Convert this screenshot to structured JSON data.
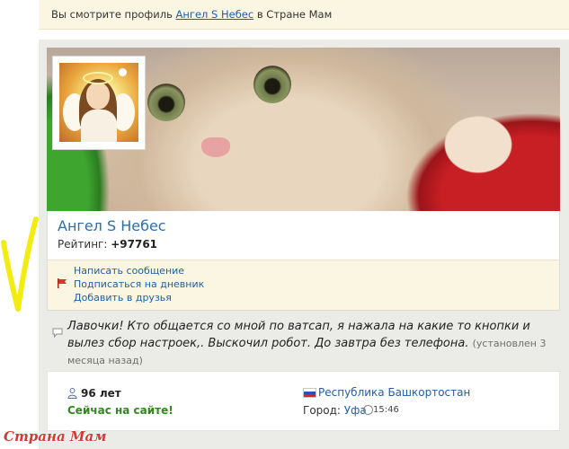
{
  "notice": {
    "prefix": "Вы смотрите профиль ",
    "profile_link": "Ангел S Небес",
    "suffix": " в Стране Мам"
  },
  "profile": {
    "name": "Ангел S Небес",
    "rating_label": "Рейтинг: ",
    "rating_value": "+97761"
  },
  "actions": [
    {
      "label": "Написать сообщение"
    },
    {
      "label": "Подписаться на дневник"
    },
    {
      "label": "Добавить в друзья"
    }
  ],
  "status": {
    "text": "Лавочки! Кто общается со мной по ватсап, я нажала на какие то кнопки и вылез сбор настроек,. Выскочил робот. До завтра без телефона.",
    "when": "(установлен 3 месяца назад)"
  },
  "info": {
    "age": "96 лет",
    "online": "Сейчас на сайте!",
    "region": "Республика Башкортостан",
    "city_label": "Город: ",
    "city": "Уфа",
    "time": "15:46"
  },
  "watermark": "Страна Мам",
  "colors": {
    "link": "#1f5fa8",
    "online": "#2e8b1a",
    "notice_bg": "#fbf6e2",
    "check_mark": "#f3ec13"
  }
}
